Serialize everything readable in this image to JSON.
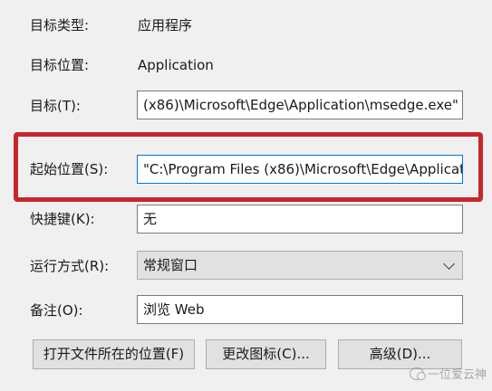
{
  "properties": {
    "target_type_label": "目标类型:",
    "target_type_value": "应用程序",
    "target_location_label": "目标位置:",
    "target_location_value": "Application",
    "target_label": "目标(T):",
    "target_value": "(x86)\\Microsoft\\Edge\\Application\\msedge.exe\"",
    "start_in_label": "起始位置(S):",
    "start_in_value": "\"C:\\Program Files (x86)\\Microsoft\\Edge\\Applicat",
    "shortcut_key_label": "快捷键(K):",
    "shortcut_key_value": "无",
    "run_label": "运行方式(R):",
    "run_value": "常规窗口",
    "comment_label": "备注(O):",
    "comment_value": "浏览 Web"
  },
  "buttons": {
    "open_location": "打开文件所在的位置(F)",
    "change_icon": "更改图标(C)...",
    "advanced": "高级(D)..."
  },
  "watermark": {
    "text": "一位爱云神"
  },
  "colors": {
    "highlight": "#c8262d",
    "focus_border": "#0078d7"
  }
}
